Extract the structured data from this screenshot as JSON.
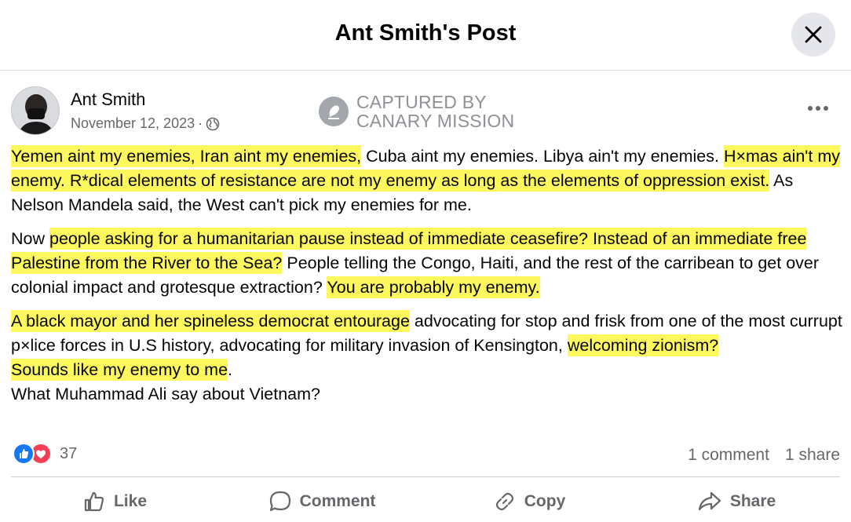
{
  "header": {
    "title": "Ant Smith's Post"
  },
  "post": {
    "author": "Ant Smith",
    "date": "November 12, 2023",
    "meta_separator": "·",
    "watermark_line1": "CAPTURED BY",
    "watermark_line2": "CANARY MISSION",
    "paragraphs": [
      [
        {
          "text": "Yemen aint my enemies, Iran aint my enemies,",
          "hl": true
        },
        {
          "text": " Cuba aint my enemies. Libya ain't my enemies. ",
          "hl": false
        },
        {
          "text": "H×mas ain't my enemy. R*dical elements of resistance are not my enemy as long as the elements of oppression exist.",
          "hl": true
        },
        {
          "text": " As Nelson Mandela said, the West can't pick my enemies for me.",
          "hl": false
        }
      ],
      [
        {
          "text": "Now ",
          "hl": false
        },
        {
          "text": "people asking for a humanitarian pause instead of immediate ceasefire? Instead of an immediate free Palestine from the River to the Sea?",
          "hl": true
        },
        {
          "text": " People telling the Congo, Haiti, and the rest of the carribean to get over colonial impact and grotesque extraction? ",
          "hl": false
        },
        {
          "text": "You are probably my enemy.",
          "hl": true
        }
      ],
      [
        {
          "text": "A black mayor and her spineless democrat entourage",
          "hl": true
        },
        {
          "text": " advocating for stop and frisk from one of the most currupt p×lice forces in U.S history, advocating for military invasion of Kensington, ",
          "hl": false
        },
        {
          "text": "welcoming zionism?",
          "hl": true
        },
        {
          "br": true
        },
        {
          "text": "Sounds like my enemy to me",
          "hl": true
        },
        {
          "text": ".",
          "hl": false
        },
        {
          "br": true
        },
        {
          "text": "What Muhammad Ali say about Vietnam?",
          "hl": false
        }
      ]
    ]
  },
  "engagement": {
    "reaction_count": "37",
    "comments": "1 comment",
    "shares": "1 share"
  },
  "actions": {
    "like": "Like",
    "comment": "Comment",
    "copy": "Copy",
    "share": "Share"
  },
  "icons": {
    "close": "close-icon",
    "globe": "globe-icon",
    "more": "more-options-icon",
    "like_reaction": "thumbs-up-reaction-icon",
    "love_reaction": "heart-reaction-icon",
    "like": "thumbs-up-icon",
    "comment": "comment-bubble-icon",
    "copy": "link-icon",
    "share": "share-arrow-icon"
  },
  "colors": {
    "highlight": "#fdf85e",
    "like_blue": "#1877f2",
    "love_red": "#f33e58",
    "secondary_text": "#65676b"
  }
}
